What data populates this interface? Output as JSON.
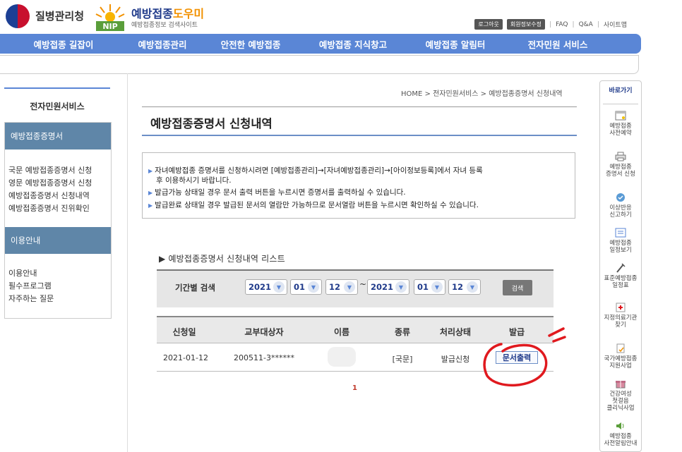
{
  "header": {
    "gov_name": "질병관리청",
    "brand_title_main": "예방접종",
    "brand_title_accent": "도우미",
    "brand_subtitle": "예방접종정보 검색사이트",
    "nip_label": "NIP",
    "links": {
      "logout": "로그아웃",
      "mypage": "회원정보수정",
      "faq": "FAQ",
      "qna": "Q&A",
      "sitemap": "사이트맵"
    }
  },
  "nav": [
    "예방접종 길잡이",
    "예방접종관리",
    "안전한 예방접종",
    "예방접종 지식창고",
    "예방접종 알림터",
    "전자민원 서비스"
  ],
  "sidebar": {
    "title": "전자민원서비스",
    "section1": "예방접종증명서",
    "links1": [
      "국문 예방접종증명서 신청",
      "영문 예방접종증명서 신청",
      "예방접종증명서 신청내역",
      "예방접종증명서 진위확인"
    ],
    "section2": "이용안내",
    "links2": [
      "이용안내",
      "필수프로그램",
      "자주하는 질문"
    ]
  },
  "breadcrumb": "HOME > 전자민원서비스 > 예방접종증명서 신청내역",
  "page_title": "예방접종증명서 신청내역",
  "info": [
    "자녀예방접종 증명서를 신청하시려면 [예방접종관리]→[자녀예방접종관리]→[아이정보등록]에서 자녀 등록",
    "후 이용하시기 바랍니다.",
    "발급가능 상태일 경우 문서 출력 버튼을 누르시면 증명서를 출력하실 수 있습니다.",
    "발급완료 상태일 경우 발급된 문서의 열람만 가능하므로 문서열람 버튼을 누르시면 확인하실 수 있습니다."
  ],
  "list_title": "▶ 예방접종증명서 신청내역 리스트",
  "filter": {
    "label": "기간별 검색",
    "from": {
      "year": "2021",
      "month": "01",
      "day": "12"
    },
    "to": {
      "year": "2021",
      "month": "01",
      "day": "12"
    },
    "tilde": "~",
    "button": "검색"
  },
  "table": {
    "headers": [
      "신청일",
      "교부대상자",
      "이름",
      "종류",
      "처리상태",
      "발급"
    ],
    "rows": [
      {
        "date": "2021-01-12",
        "target": "200511-3******",
        "name": "",
        "type": "[국문]",
        "status": "발급신청",
        "action": "문서출력"
      }
    ]
  },
  "pager": "1",
  "quickbar": {
    "title": "바로가기",
    "items": [
      [
        "예방접종",
        "사전예약"
      ],
      [
        "예방접종",
        "증명서 신청"
      ],
      [
        "이상반응",
        "신고하기"
      ],
      [
        "예방접종",
        "일정보기"
      ],
      [
        "표준예방접종",
        "일정표"
      ],
      [
        "지정의료기관",
        "찾기"
      ],
      [
        "국가예방접종",
        "지원사업"
      ],
      [
        "건강여성",
        "첫걸음",
        "클리닉사업"
      ],
      [
        "예방접종",
        "사전알림안내"
      ]
    ]
  },
  "colors": {
    "nav": "#5a86d6",
    "sidebar_head": "#5f86a8",
    "annotation": "#e0191e"
  }
}
